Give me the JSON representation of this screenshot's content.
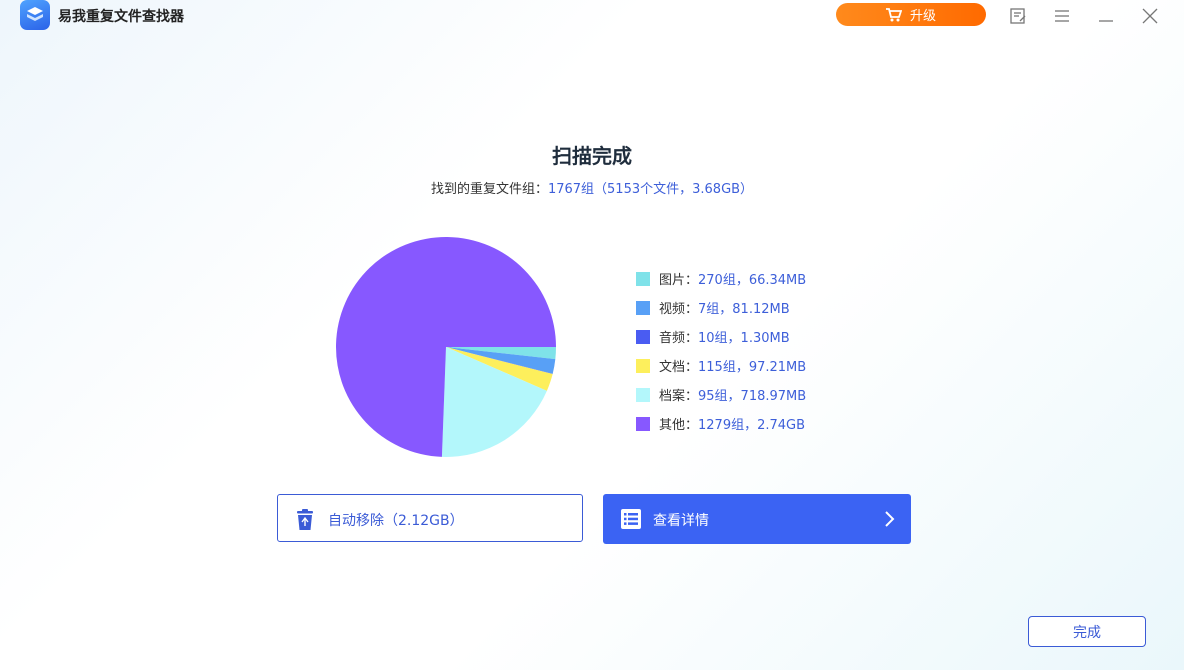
{
  "app": {
    "title": "易我重复文件查找器"
  },
  "toolbar": {
    "upgrade_label": "升级"
  },
  "scan": {
    "title": "扫描完成",
    "summary_prefix": "找到的重复文件组：",
    "summary_value": "1767组（5153个文件，3.68GB）"
  },
  "chart_data": {
    "type": "pie",
    "slices": [
      {
        "name": "图片",
        "label": "图片：",
        "value_text": "270组，66.34MB",
        "groups": 270,
        "size_mb": 66.34,
        "color": "#7fe2e9"
      },
      {
        "name": "视频",
        "label": "视频：",
        "value_text": "7组，81.12MB",
        "groups": 7,
        "size_mb": 81.12,
        "color": "#58a0f6"
      },
      {
        "name": "音频",
        "label": "音频：",
        "value_text": "10组，1.30MB",
        "groups": 10,
        "size_mb": 1.3,
        "color": "#4a5cf2"
      },
      {
        "name": "文档",
        "label": "文档：",
        "value_text": "115组，97.21MB",
        "groups": 115,
        "size_mb": 97.21,
        "color": "#fdef5c"
      },
      {
        "name": "档案",
        "label": "档案：",
        "value_text": "95组，718.97MB",
        "groups": 95,
        "size_mb": 718.97,
        "color": "#b3f7fb"
      },
      {
        "name": "其他",
        "label": "其他：",
        "value_text": "1279组，2.74GB",
        "groups": 1279,
        "size_mb": 2805.76,
        "color": "#8758ff"
      }
    ]
  },
  "actions": {
    "auto_remove_label": "自动移除（2.12GB）",
    "view_details_label": "查看详情",
    "done_label": "完成"
  }
}
